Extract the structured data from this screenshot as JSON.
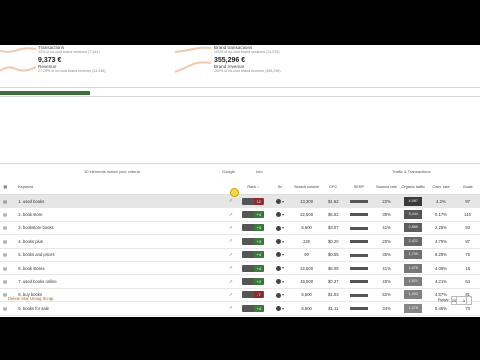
{
  "stats": {
    "left_top": {
      "label": "Transactions",
      "sub": "22% of no-cost brand sessions (7,544)"
    },
    "left_rev": {
      "value": "9,373 €",
      "label": "Revenue",
      "sub": "27.29% of no-cost brand revenue (34,348)"
    },
    "right_top": {
      "label": "Brand transactions",
      "sub": "100% of no-cost brand sessions (24,576)"
    },
    "right_rev": {
      "value": "355,296 €",
      "label": "Brand revenue",
      "sub": "100% of no-cost brand revenue (355,296)"
    }
  },
  "table_meta": {
    "count_text": "10 elements match your criteria",
    "col_group_google": "Google",
    "col_group_info": "Info",
    "col_group_traffic": "Traffic & Transactions"
  },
  "headers": {
    "keyword": "Keyword",
    "rank": "Rank ↓",
    "sv": "Sv",
    "search_volume": "Search volume",
    "cpc": "CPC",
    "serp": "SERP",
    "bounce": "Bounce rate",
    "organic": "Organic traffic",
    "conv": "Conv. rate",
    "goals": "Goals"
  },
  "rows": [
    {
      "kw": "1. used books",
      "rank": "12",
      "rank_color": "#8a2d2d",
      "sv": "13,300",
      "cpc": "$1.52",
      "bounce": "22%",
      "org": "4,987",
      "conv": "4.2%",
      "goals": "97",
      "hl": true
    },
    {
      "kw": "2. book store",
      "rank": "+4",
      "rank_color": "#3e7a3e",
      "sv": "22,500",
      "cpc": "$6.52",
      "bounce": "39%",
      "org": "3,444",
      "conv": "0.17%",
      "goals": "110",
      "hl": false
    },
    {
      "kw": "3. bookstore books",
      "rank": "+5",
      "rank_color": "#3e7a3e",
      "sv": "6,600",
      "cpc": "$3.07",
      "bounce": "41%",
      "org": "2,889",
      "conv": "2.25%",
      "goals": "93",
      "hl": false
    },
    {
      "kw": "4. books plus",
      "rank": "+3",
      "rank_color": "#3e7a3e",
      "sv": "220",
      "cpc": "$0.20",
      "bounce": "20%",
      "org": "2,421",
      "conv": "4.79%",
      "goals": "87",
      "hl": false
    },
    {
      "kw": "5. books and prices",
      "rank": "+4",
      "rank_color": "#3e7a3e",
      "sv": "90",
      "cpc": "$0.55",
      "bounce": "35%",
      "org": "1,799",
      "conv": "6.29%",
      "goals": "76",
      "hl": false
    },
    {
      "kw": "6. book stores",
      "rank": "+4",
      "rank_color": "#3e7a3e",
      "sv": "22,500",
      "cpc": "$6.08",
      "bounce": "41%",
      "org": "1,678",
      "conv": "4.09%",
      "goals": "18",
      "hl": false
    },
    {
      "kw": "7. used books online",
      "rank": "+2",
      "rank_color": "#3e7a3e",
      "sv": "49,500",
      "cpc": "$0.37",
      "bounce": "40%",
      "org": "1,521",
      "conv": "4.21%",
      "goals": "64",
      "hl": false
    },
    {
      "kw": "8. buy books",
      "rank": "-7",
      "rank_color": "#8a2d2d",
      "sv": "6,600",
      "cpc": "$1.03",
      "bounce": "52%",
      "org": "1,403",
      "conv": "4.57%",
      "goals": "81",
      "hl": false
    },
    {
      "kw": "9. books for sale",
      "rank": "+4",
      "rank_color": "#3e7a3e",
      "sv": "6,600",
      "cpc": "$1.11",
      "bounce": "34%",
      "org": "1,376",
      "conv": "5.46%",
      "goals": "70",
      "hl": false
    },
    {
      "kw": "10. bargain books",
      "rank": "+4",
      "rank_color": "#3e7a3e",
      "sv": "6,600",
      "cpc": "$0.09",
      "bounce": "52%",
      "org": "1,203",
      "conv": "6.09%",
      "goals": "90",
      "hl": false
    }
  ],
  "footer": {
    "links": "Delete  Star  Untag  Scrap",
    "rows_label": "Rows:",
    "rows_value": "25",
    "page": "1"
  },
  "colors": {
    "accent": "#3f6e3f",
    "footer_link": "#b5651d"
  }
}
